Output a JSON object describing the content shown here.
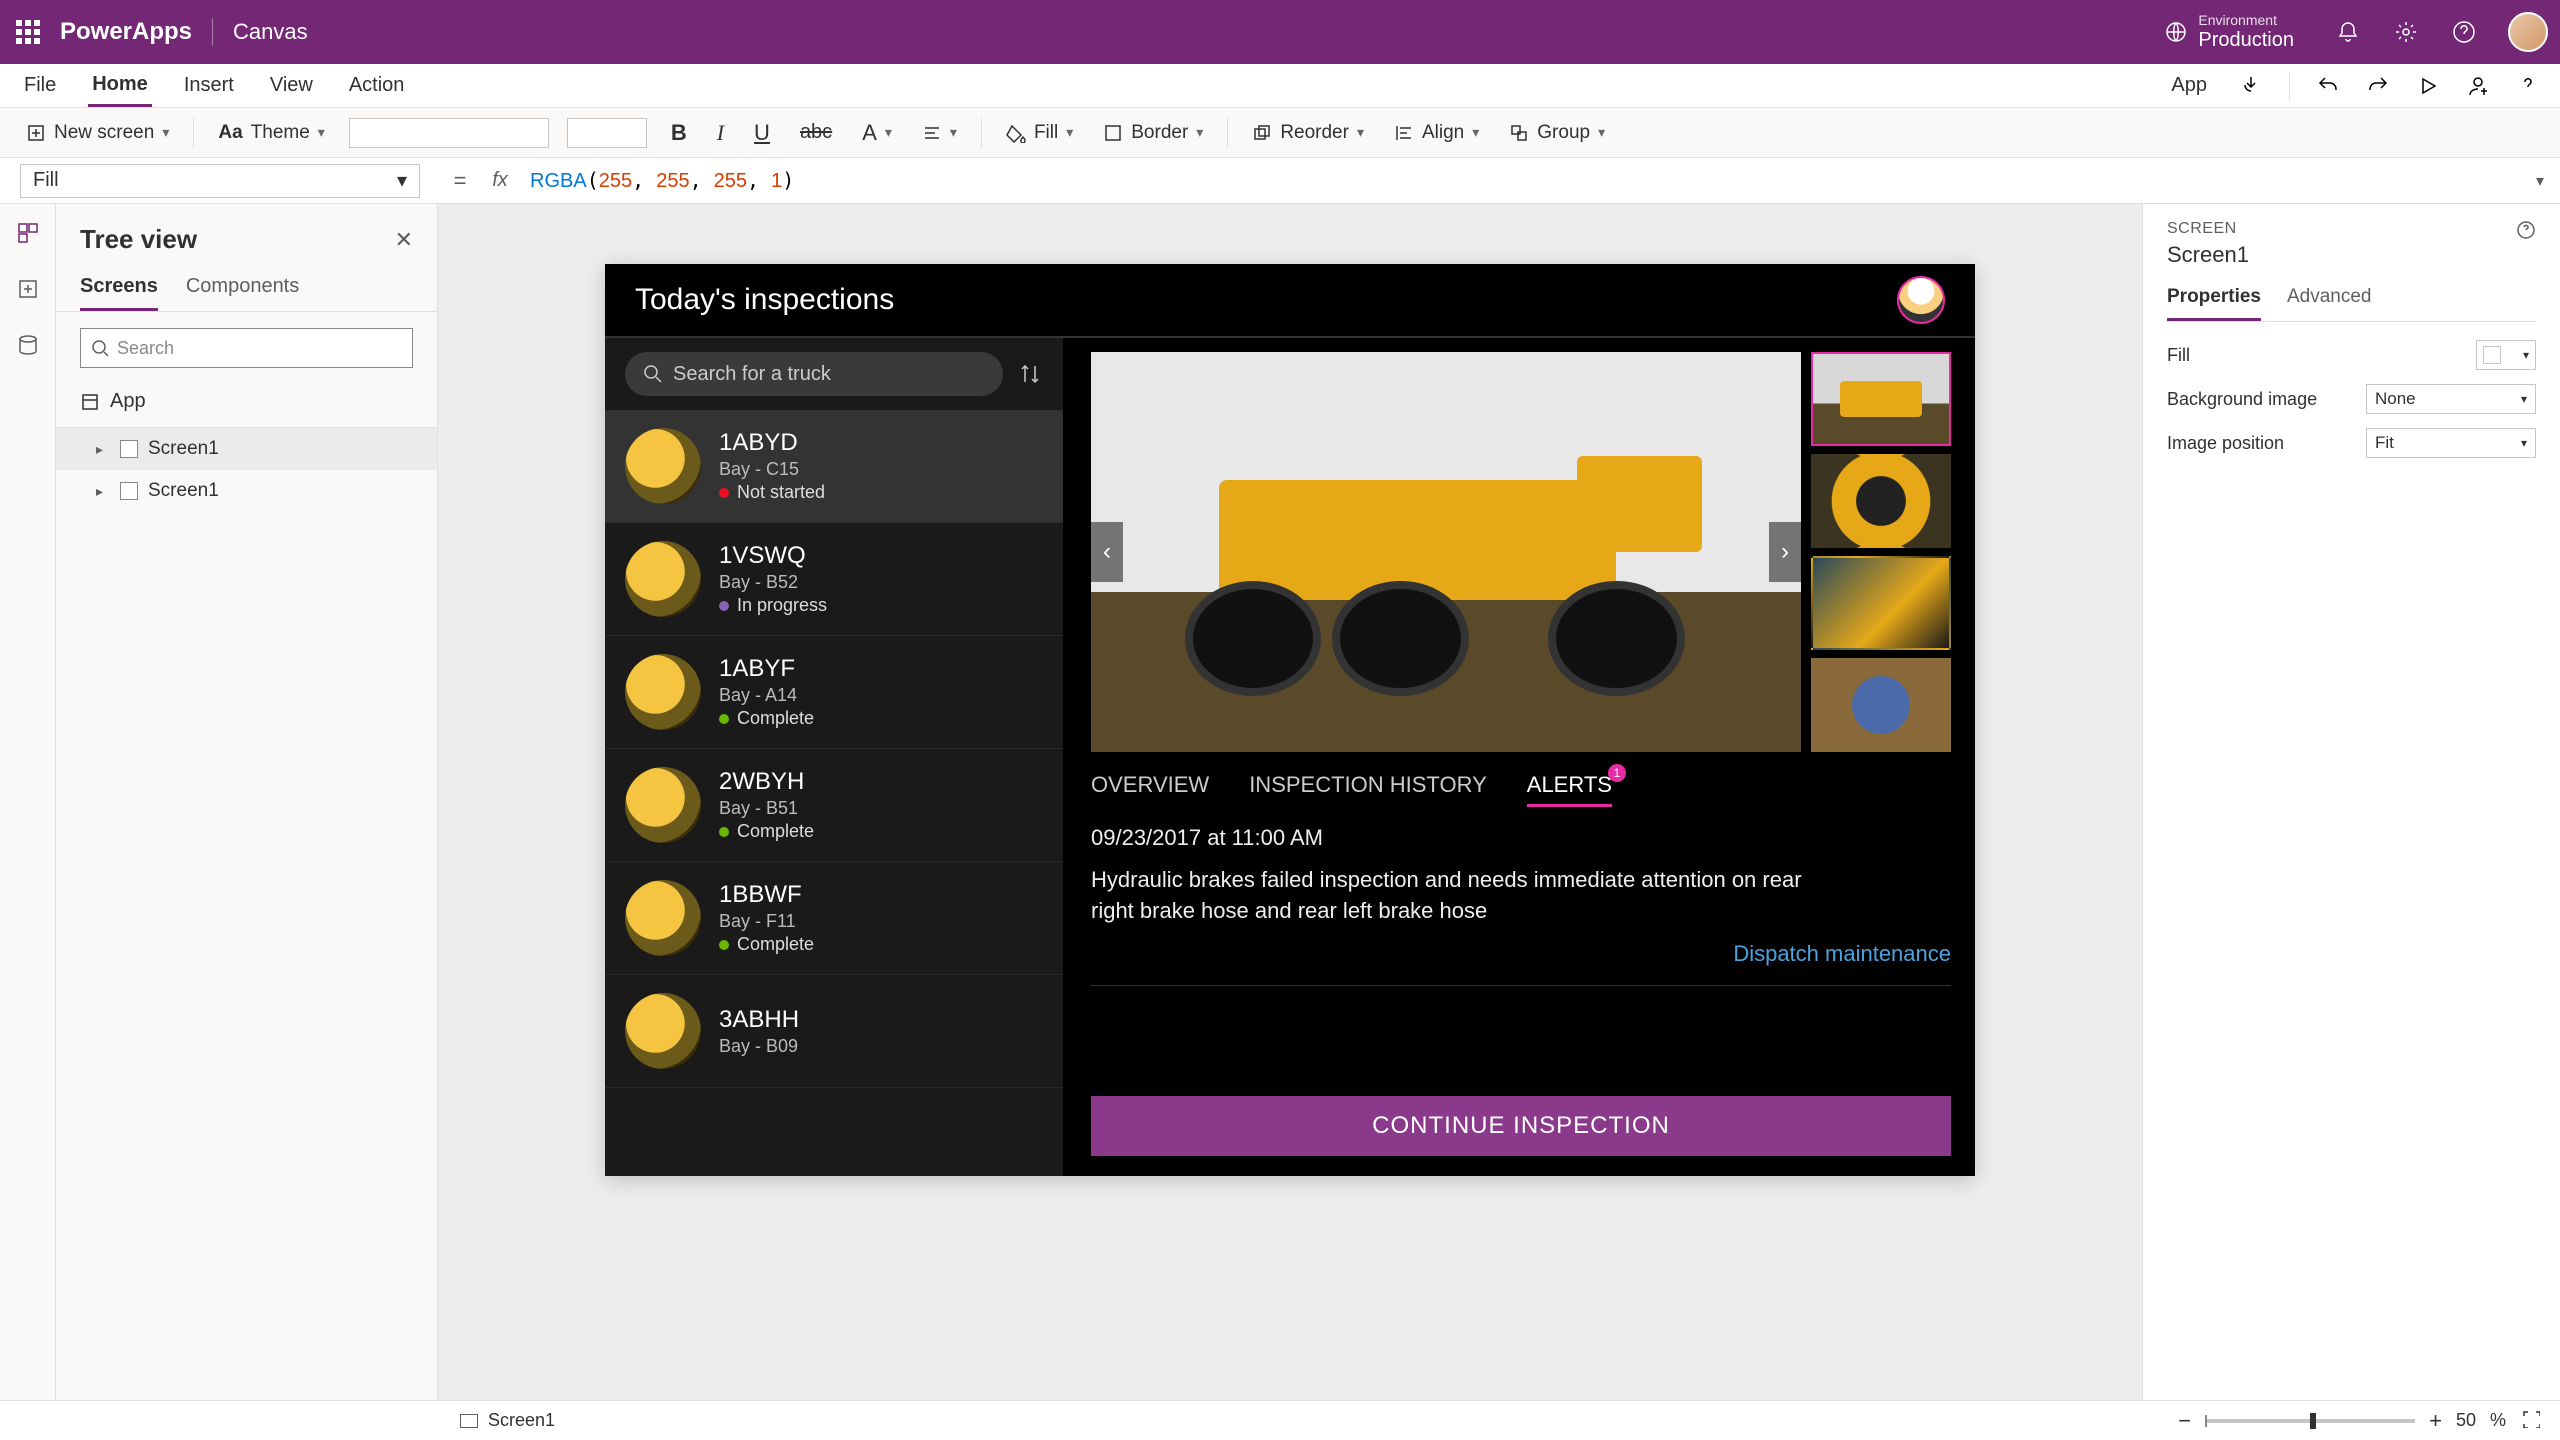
{
  "titlebar": {
    "brand": "PowerApps",
    "mode": "Canvas",
    "env_label": "Environment",
    "env_value": "Production"
  },
  "menu": {
    "file": "File",
    "home": "Home",
    "insert": "Insert",
    "view": "View",
    "action": "Action",
    "app": "App"
  },
  "ribbon": {
    "new_screen": "New screen",
    "theme": "Theme",
    "fill": "Fill",
    "border": "Border",
    "reorder": "Reorder",
    "align": "Align",
    "group": "Group"
  },
  "formula": {
    "property": "Fill",
    "fn": "RGBA",
    "a1": "255",
    "a2": "255",
    "a3": "255",
    "a4": "1"
  },
  "tree": {
    "title": "Tree view",
    "tab_screens": "Screens",
    "tab_components": "Components",
    "search_placeholder": "Search",
    "app": "App",
    "nodes": [
      "Screen1",
      "Screen1"
    ]
  },
  "device": {
    "title": "Today's inspections",
    "search_placeholder": "Search for a truck",
    "items": [
      {
        "id": "1ABYD",
        "bay": "Bay - C15",
        "status": "Not started",
        "dot": "red",
        "selected": true
      },
      {
        "id": "1VSWQ",
        "bay": "Bay - B52",
        "status": "In progress",
        "dot": "purple"
      },
      {
        "id": "1ABYF",
        "bay": "Bay - A14",
        "status": "Complete",
        "dot": "green"
      },
      {
        "id": "2WBYH",
        "bay": "Bay - B51",
        "status": "Complete",
        "dot": "green"
      },
      {
        "id": "1BBWF",
        "bay": "Bay - F11",
        "status": "Complete",
        "dot": "green"
      },
      {
        "id": "3ABHH",
        "bay": "Bay - B09",
        "status": "",
        "dot": "green"
      }
    ],
    "tab_overview": "OVERVIEW",
    "tab_history": "INSPECTION HISTORY",
    "tab_alerts": "ALERTS",
    "alerts_badge": "1",
    "datetime": "09/23/2017 at 11:00 AM",
    "description": "Hydraulic brakes failed inspection and needs immediate attention on rear right brake hose and rear left brake hose",
    "dispatch": "Dispatch maintenance",
    "cta": "CONTINUE INSPECTION"
  },
  "props": {
    "kind": "SCREEN",
    "name": "Screen1",
    "tab_props": "Properties",
    "tab_adv": "Advanced",
    "fill": "Fill",
    "bgimg": "Background image",
    "bgimg_val": "None",
    "imgpos": "Image position",
    "imgpos_val": "Fit"
  },
  "status": {
    "screen": "Screen1",
    "zoom": "50",
    "pct": "%"
  }
}
